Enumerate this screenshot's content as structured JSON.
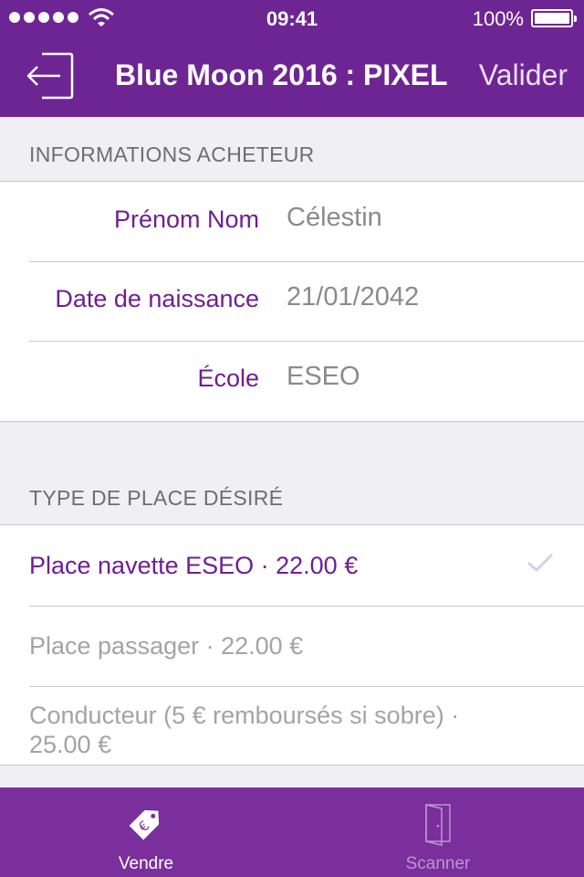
{
  "status_bar": {
    "time": "09:41",
    "battery": "100%"
  },
  "nav": {
    "title": "Blue Moon 2016 : PIXEL",
    "action": "Valider"
  },
  "buyer_section": {
    "header": "INFORMATIONS ACHETEUR",
    "fields": [
      {
        "label": "Prénom Nom",
        "value": "Célestin"
      },
      {
        "label": "Date de naissance",
        "value": "21/01/2042"
      },
      {
        "label": "École",
        "value": "ESEO"
      }
    ]
  },
  "place_section": {
    "header": "TYPE DE PLACE DÉSIRÉ",
    "options": [
      {
        "label": "Place navette ESEO · 22.00 €",
        "selected": true
      },
      {
        "label": "Place passager · 22.00 €",
        "selected": false
      },
      {
        "label": "Conducteur (5 € remboursés si sobre) · 25.00 €",
        "selected": false
      }
    ]
  },
  "tabs": [
    {
      "label": "Vendre",
      "icon": "price-tag-icon",
      "active": true
    },
    {
      "label": "Scanner",
      "icon": "door-icon",
      "active": false
    }
  ],
  "colors": {
    "brand": "#6e2594",
    "accent_text": "#6e1f91",
    "tabbar": "#7a2f9d"
  }
}
